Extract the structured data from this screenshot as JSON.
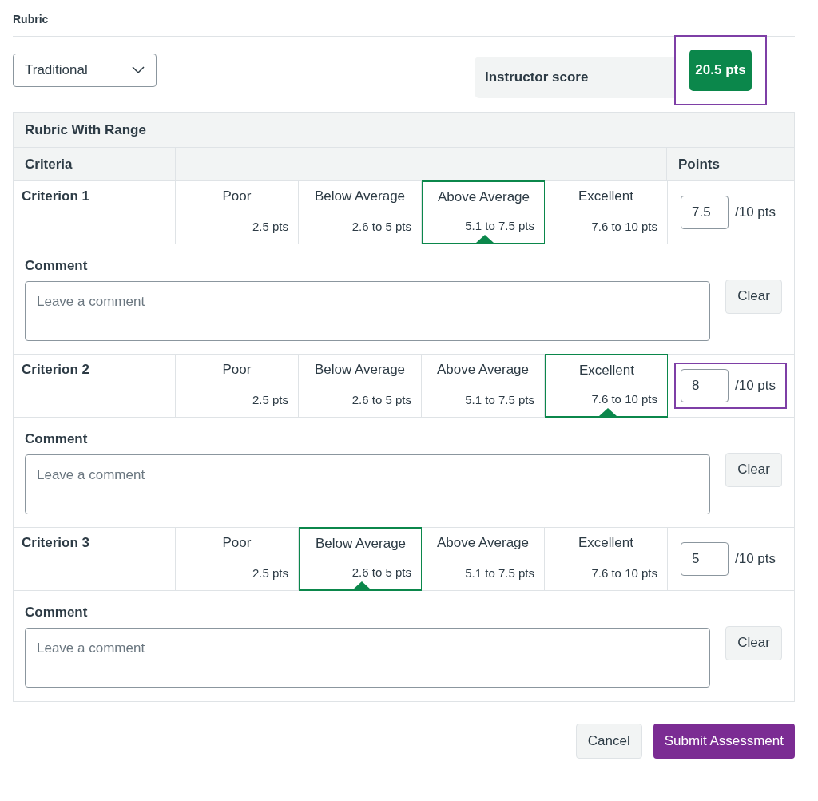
{
  "title": "Rubric",
  "dropdown": {
    "value": "Traditional"
  },
  "score": {
    "label": "Instructor score",
    "value": "20.5 pts",
    "highlighted": true
  },
  "table": {
    "title": "Rubric With Range",
    "columns": [
      "Criteria",
      "Points"
    ],
    "criteria": [
      {
        "name": "Criterion 1",
        "ratings": [
          {
            "label": "Poor",
            "points": "2.5 pts",
            "selected": false
          },
          {
            "label": "Below Average",
            "points": "2.6 to 5 pts",
            "selected": false
          },
          {
            "label": "Above Average",
            "points": "5.1 to 7.5 pts",
            "selected": true
          },
          {
            "label": "Excellent",
            "points": "7.6 to 10 pts",
            "selected": false
          }
        ],
        "points": "7.5",
        "out_of": "/10 pts",
        "highlighted": false,
        "comment_label": "Comment",
        "comment_placeholder": "Leave a comment",
        "clear": "Clear"
      },
      {
        "name": "Criterion 2",
        "ratings": [
          {
            "label": "Poor",
            "points": "2.5 pts",
            "selected": false
          },
          {
            "label": "Below Average",
            "points": "2.6 to 5 pts",
            "selected": false
          },
          {
            "label": "Above Average",
            "points": "5.1 to 7.5 pts",
            "selected": false
          },
          {
            "label": "Excellent",
            "points": "7.6 to 10 pts",
            "selected": true
          }
        ],
        "points": "8",
        "out_of": "/10 pts",
        "highlighted": true,
        "comment_label": "Comment",
        "comment_placeholder": "Leave a comment",
        "clear": "Clear"
      },
      {
        "name": "Criterion 3",
        "ratings": [
          {
            "label": "Poor",
            "points": "2.5 pts",
            "selected": false
          },
          {
            "label": "Below Average",
            "points": "2.6 to 5 pts",
            "selected": true
          },
          {
            "label": "Above Average",
            "points": "5.1 to 7.5 pts",
            "selected": false
          },
          {
            "label": "Excellent",
            "points": "7.6 to 10 pts",
            "selected": false
          }
        ],
        "points": "5",
        "out_of": "/10 pts",
        "highlighted": false,
        "comment_label": "Comment",
        "comment_placeholder": "Leave a comment",
        "clear": "Clear"
      }
    ]
  },
  "buttons": {
    "cancel": "Cancel",
    "submit": "Submit Assessment"
  }
}
